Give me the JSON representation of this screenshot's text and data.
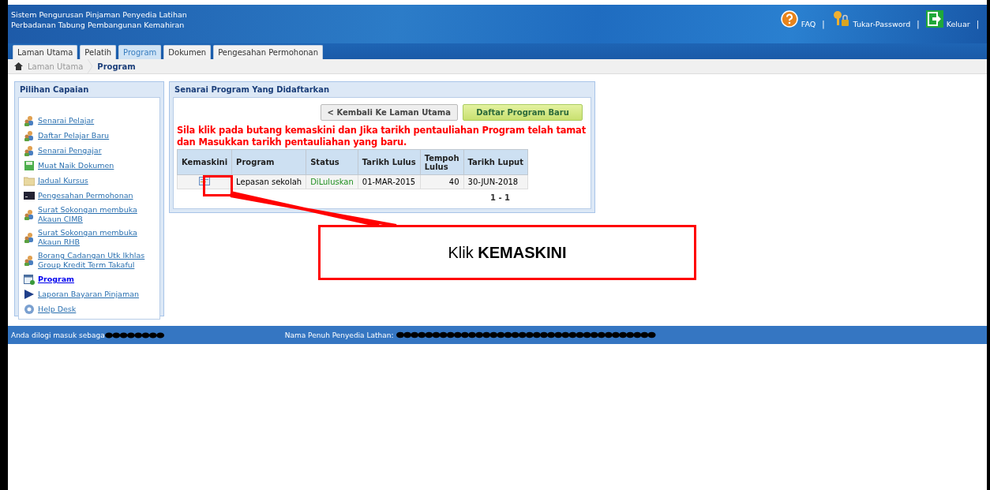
{
  "header": {
    "title": "Sistem Pengurusan Pinjaman Penyedia Latihan",
    "subtitle": "Perbadanan Tabung Pembangunan Kemahiran",
    "links": [
      {
        "label": "FAQ"
      },
      {
        "label": "Tukar-Password"
      },
      {
        "label": "Keluar"
      }
    ],
    "separator": "|"
  },
  "tabs": [
    {
      "label": "Laman Utama",
      "selected": false
    },
    {
      "label": "Pelatih",
      "selected": false
    },
    {
      "label": "Program",
      "selected": true
    },
    {
      "label": "Dokumen",
      "selected": false
    },
    {
      "label": "Pengesahan Permohonan",
      "selected": false
    }
  ],
  "breadcrumb": [
    "Laman Utama",
    "Program"
  ],
  "sidebar": {
    "title": "Pilihan Capaian",
    "items": [
      {
        "label": "Senarai Pelajar",
        "selected": false
      },
      {
        "label": "Daftar Pelajar Baru",
        "selected": false
      },
      {
        "label": "Senarai Pengajar",
        "selected": false
      },
      {
        "label": "Muat Naik Dokumen",
        "selected": false
      },
      {
        "label": "Jadual Kursus",
        "selected": false
      },
      {
        "label": "Pengesahan Permohonan",
        "selected": false
      },
      {
        "label": "Surat Sokongan membuka Akaun CIMB",
        "selected": false
      },
      {
        "label": "Surat Sokongan membuka Akaun RHB",
        "selected": false
      },
      {
        "label": "Borang Cadangan Utk Ikhlas Group Kredit Term Takaful",
        "selected": false
      },
      {
        "label": "Program",
        "selected": true
      },
      {
        "label": "Laporan Bayaran Pinjaman",
        "selected": false
      },
      {
        "label": "Help Desk",
        "selected": false
      }
    ]
  },
  "main": {
    "title": "Senarai Program Yang Didaftarkan",
    "buttons": [
      {
        "label": "< Kembali Ke Laman Utama",
        "kind": "back"
      },
      {
        "label": "Daftar Program Baru",
        "kind": "primary"
      }
    ],
    "notice": "Sila klik pada butang kemaskini dan Jika tarikh pentauliahan Program telah tamat dan Masukkan tarikh pentauliahan yang baru.",
    "table": {
      "columns": [
        "Kemaskini",
        "Program",
        "Status",
        "Tarikh Lulus",
        "Tempoh Lulus",
        "Tarikh Luput"
      ],
      "rows": [
        {
          "program": "Lepasan sekolah",
          "status": "DiLuluskan",
          "tarikh_lulus": "01-MAR-2015",
          "tempoh_lulus": "40",
          "tarikh_luput": "30-JUN-2018"
        }
      ]
    },
    "pager": "1 - 1"
  },
  "footer": {
    "login_label": "Anda dilogi masuk sebaga",
    "name_label": "Nama Penuh Penyedia Lathan:"
  },
  "callout": {
    "text": "Klik **KEMASKINI**"
  }
}
